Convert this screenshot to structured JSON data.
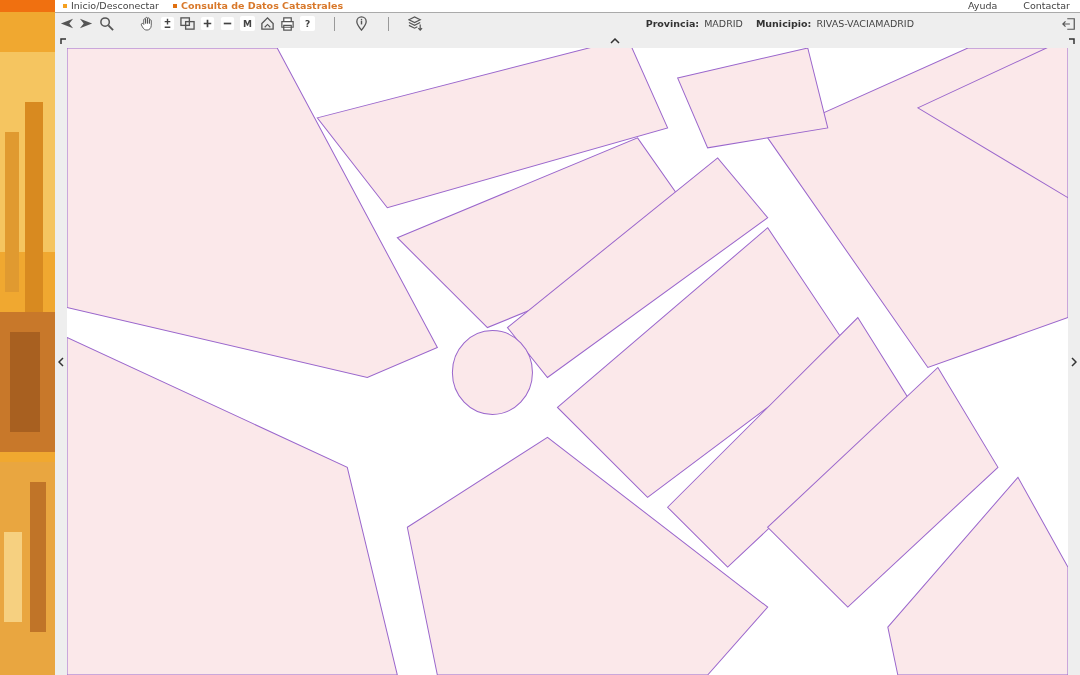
{
  "header": {
    "links": [
      {
        "label": "Inicio/Desconectar",
        "kind": "plain"
      },
      {
        "label": "Consulta de Datos Catastrales",
        "kind": "current"
      },
      {
        "label": "Ayuda",
        "kind": "right"
      },
      {
        "label": "Contactar",
        "kind": "right"
      }
    ]
  },
  "toolbar": {
    "tools": [
      {
        "kind": "back"
      },
      {
        "kind": "forward"
      },
      {
        "kind": "search"
      },
      {
        "kind": "gap"
      },
      {
        "kind": "hand"
      },
      {
        "kind": "plusminus"
      },
      {
        "kind": "window"
      },
      {
        "kind": "plus"
      },
      {
        "kind": "minus"
      },
      {
        "kind": "text",
        "label": "M"
      },
      {
        "kind": "home"
      },
      {
        "kind": "print"
      },
      {
        "kind": "text",
        "label": "?"
      },
      {
        "kind": "sep"
      },
      {
        "kind": "info"
      },
      {
        "kind": "sep"
      },
      {
        "kind": "layers"
      }
    ],
    "location": [
      {
        "label": "Provincia:",
        "value": "MADRID"
      },
      {
        "label": "Municipio:",
        "value": "RIVAS-VACIAMADRID"
      }
    ]
  }
}
